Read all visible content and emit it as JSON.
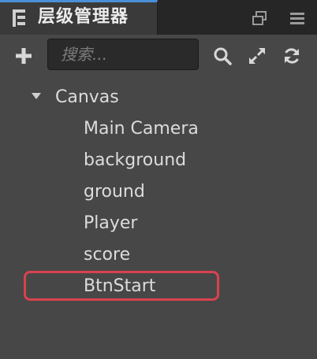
{
  "tab": {
    "title": "层级管理器",
    "icon": "hierarchy-icon",
    "actions": [
      "popout-icon",
      "menu-icon"
    ]
  },
  "toolbar": {
    "add_icon": "plus-icon",
    "search_placeholder": "搜索...",
    "search_value": "",
    "search_icon": "search-icon",
    "expand_icon": "expand-icon",
    "refresh_icon": "refresh-icon"
  },
  "tree": {
    "root": {
      "label": "Canvas",
      "expanded": true,
      "children": [
        {
          "label": "Main Camera"
        },
        {
          "label": "background"
        },
        {
          "label": "ground"
        },
        {
          "label": "Player"
        },
        {
          "label": "score"
        },
        {
          "label": "BtnStart",
          "highlighted": true
        }
      ]
    }
  },
  "colors": {
    "panel_bg": "#474747",
    "tab_accent": "#4a8fd8",
    "highlight": "#d9414f",
    "text": "#dcdcdc"
  }
}
